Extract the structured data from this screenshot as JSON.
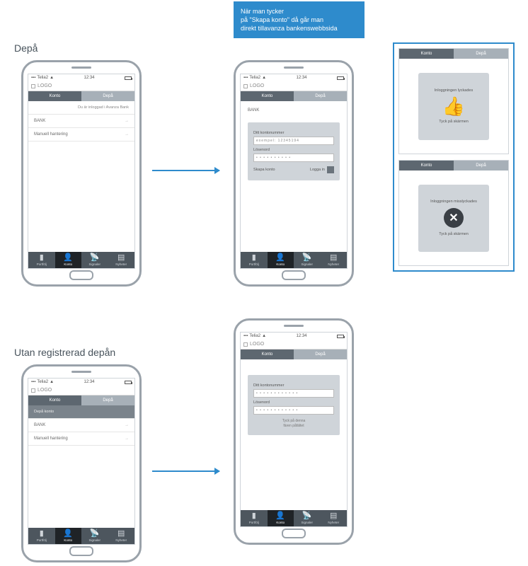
{
  "note": {
    "line1": "När man tycker",
    "line2": "på \"Skapa konto\" då går man",
    "line3": "direkt tillavanza bankenswebbsida"
  },
  "sections": {
    "depa": "Depå",
    "utan": "Utan registrerad depån"
  },
  "status": {
    "carrier": "Telia2",
    "time": "12:34"
  },
  "logo": "LOGO",
  "tabs": {
    "konto": "Konto",
    "depa": "Depå"
  },
  "nav": {
    "portfolj": "Portfölj",
    "konto": "Konto",
    "signaler": "Signaler",
    "nyheter": "Nyheter"
  },
  "p1": {
    "head": "Du är inloggad i Avanza Bank",
    "row_bank": "BANK",
    "row_manual": "Manuell hantering"
  },
  "p2": {
    "bank": "BANK",
    "lbl_konto": "Ditt kontonummer",
    "val_konto": "exempel: 12345194",
    "lbl_pw": "Lösenord",
    "val_pw": "• • • • • • • • • •",
    "skapa": "Skapa konto",
    "login": "Logga in"
  },
  "p3": {
    "head": "Depå konto",
    "row_bank": "BANK",
    "row_manual": "Manuell hantering"
  },
  "p4": {
    "lbl_konto": "Ditt kontonummer",
    "val_konto": "• • • • • • • • • • • •",
    "lbl_pw": "Lösenord",
    "val_pw": "• • • • • • • • • • • •",
    "hint1": "Tyck på denna",
    "hint2": "fären påfältet"
  },
  "results": {
    "ok_title": "Inloggningen lyckades",
    "ok_sub": "Tyck på skärmen",
    "fail_title": "Inloggningen misslyckades",
    "fail_sub": "Tyck på skärmen"
  }
}
